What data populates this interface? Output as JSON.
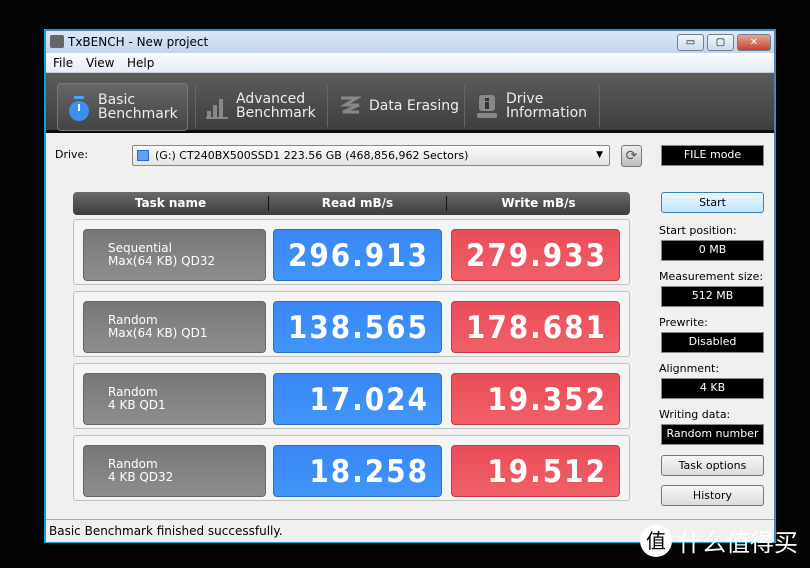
{
  "window": {
    "title": "TxBENCH - New project",
    "min": "▭",
    "max": "▢",
    "close": "✕"
  },
  "menu": [
    "File",
    "View",
    "Help"
  ],
  "toolbar": {
    "tabs": [
      {
        "line1": "Basic",
        "line2": "Benchmark",
        "icon": "stopwatch-icon",
        "active": true
      },
      {
        "line1": "Advanced",
        "line2": "Benchmark",
        "icon": "bar-chart-icon"
      },
      {
        "line1": "Data Erasing",
        "line2": "",
        "icon": "eraser-icon"
      },
      {
        "line1": "Drive",
        "line2": "Information",
        "icon": "info-icon"
      }
    ]
  },
  "drive": {
    "label": "Drive:",
    "value": "(G:) CT240BX500SSD1  223.56 GB (468,856,962 Sectors)",
    "mode": "FILE mode"
  },
  "table": {
    "headers": [
      "Task name",
      "Read mB/s",
      "Write mB/s"
    ],
    "rows": [
      {
        "l1": "Sequential",
        "l2": "Max(64 KB) QD32",
        "read": "296.913",
        "write": "279.933"
      },
      {
        "l1": "Random",
        "l2": "Max(64 KB) QD1",
        "read": "138.565",
        "write": "178.681"
      },
      {
        "l1": "Random",
        "l2": "4 KB QD1",
        "read": "17.024",
        "write": "19.352"
      },
      {
        "l1": "Random",
        "l2": "4 KB QD32",
        "read": "18.258",
        "write": "19.512"
      }
    ]
  },
  "panel": {
    "start": "Start",
    "fields": [
      {
        "label": "Start position:",
        "value": "0 MB"
      },
      {
        "label": "Measurement size:",
        "value": "512 MB"
      },
      {
        "label": "Prewrite:",
        "value": "Disabled"
      },
      {
        "label": "Alignment:",
        "value": "4 KB"
      },
      {
        "label": "Writing data:",
        "value": "Random number"
      }
    ],
    "task_options": "Task options",
    "history": "History"
  },
  "status": "Basic Benchmark finished successfully.",
  "watermark": {
    "badge": "值",
    "text": "什么值得买"
  },
  "colors": {
    "read": "#3f8ff7",
    "write": "#ee5862"
  }
}
